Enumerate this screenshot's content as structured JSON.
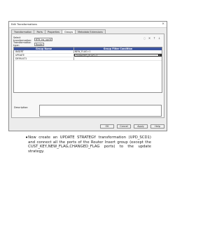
{
  "dialog": {
    "title": "Edit Transformations",
    "close_symbol": "×",
    "tabs": [
      {
        "label": "Transformation"
      },
      {
        "label": "Ports"
      },
      {
        "label": "Properties"
      },
      {
        "label": "Groups"
      },
      {
        "label": "Metadata Extensions"
      }
    ],
    "select_transformation_label": "Select transformation:",
    "select_transformation_value": "RTR_ins_upd",
    "transformation_type_label": "Transformation type:",
    "transformation_type_value": "Router",
    "grid": {
      "headers": [
        "Group Name",
        "Group Filter Condition"
      ],
      "rows": [
        {
          "name": "INSERT",
          "condition": "NEW_FLAG=1"
        },
        {
          "name": "UPDATE",
          "condition": "CHANGED_FLAG=1"
        },
        {
          "name": "DEFAULT1",
          "condition": ""
        }
      ]
    },
    "description_label": "Description:",
    "buttons": {
      "ok": "OK",
      "cancel": "Cancel",
      "apply": "Apply",
      "help": "Help"
    }
  },
  "bullet_text": "Now create an UPDATE STRATEGY transformation (UPD_SCD1) and connect all the ports of the Router Insert group (except the CUST_KEY,NEW_FLAG,CHANGED_FLAG ports) to the update strategy.",
  "icons": [
    "add-row-icon",
    "delete-row-icon",
    "move-up-icon",
    "move-down-icon"
  ]
}
